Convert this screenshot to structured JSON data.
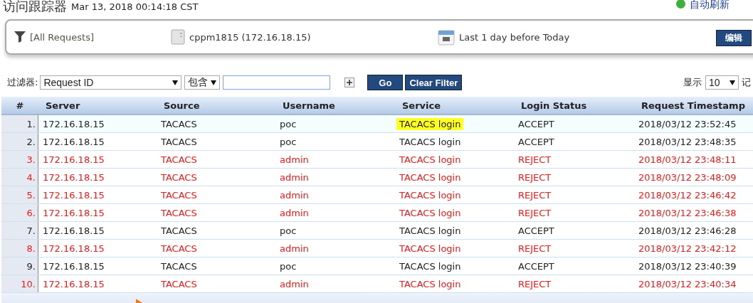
{
  "header": {
    "title": "访问跟踪器",
    "timestamp": "Mar 13, 2018 00:14:18 CST",
    "auto_refresh": {
      "label": "自动刷新",
      "on": true
    }
  },
  "summary": {
    "filter": "[All Requests]",
    "server": "cppm1815 (172.16.18.15)",
    "date_range": "Last 1 day before Today",
    "edit_button": "编辑"
  },
  "filter_bar": {
    "label": "过滤器:",
    "field": "Request ID",
    "operator": "包含",
    "go_button": "Go",
    "clear_button": "Clear Filter",
    "show_label": "显示",
    "page_size": "10",
    "records_label": "记"
  },
  "table": {
    "columns": [
      "#",
      "Server",
      "Source",
      "Username",
      "Service",
      "Login Status",
      "Request Timestamp"
    ],
    "rows": [
      {
        "cells": [
          "1.",
          "172.16.18.15",
          "TACACS",
          "poc",
          "TACACS login",
          "ACCEPT",
          "2018/03/12 23:52:45"
        ],
        "rejected": false,
        "selected": true
      },
      {
        "cells": [
          "2.",
          "172.16.18.15",
          "TACACS",
          "poc",
          "TACACS login",
          "ACCEPT",
          "2018/03/12 23:48:35"
        ],
        "rejected": false,
        "selected": false
      },
      {
        "cells": [
          "3.",
          "172.16.18.15",
          "TACACS",
          "admin",
          "TACACS login",
          "REJECT",
          "2018/03/12 23:48:11"
        ],
        "rejected": true,
        "selected": false
      },
      {
        "cells": [
          "4.",
          "172.16.18.15",
          "TACACS",
          "admin",
          "TACACS login",
          "REJECT",
          "2018/03/12 23:48:09"
        ],
        "rejected": true,
        "selected": false
      },
      {
        "cells": [
          "5.",
          "172.16.18.15",
          "TACACS",
          "admin",
          "TACACS login",
          "REJECT",
          "2018/03/12 23:46:42"
        ],
        "rejected": true,
        "selected": false
      },
      {
        "cells": [
          "6.",
          "172.16.18.15",
          "TACACS",
          "admin",
          "TACACS login",
          "REJECT",
          "2018/03/12 23:46:38"
        ],
        "rejected": true,
        "selected": false
      },
      {
        "cells": [
          "7.",
          "172.16.18.15",
          "TACACS",
          "poc",
          "TACACS login",
          "ACCEPT",
          "2018/03/12 23:46:28"
        ],
        "rejected": false,
        "selected": false
      },
      {
        "cells": [
          "8.",
          "172.16.18.15",
          "TACACS",
          "admin",
          "TACACS login",
          "REJECT",
          "2018/03/12 23:42:12"
        ],
        "rejected": true,
        "selected": false
      },
      {
        "cells": [
          "9.",
          "172.16.18.15",
          "TACACS",
          "poc",
          "TACACS login",
          "ACCEPT",
          "2018/03/12 23:40:39"
        ],
        "rejected": false,
        "selected": false
      },
      {
        "cells": [
          "10.",
          "172.16.18.15",
          "TACACS",
          "admin",
          "TACACS login",
          "REJECT",
          "2018/03/12 23:40:34"
        ],
        "rejected": true,
        "selected": false
      }
    ]
  }
}
